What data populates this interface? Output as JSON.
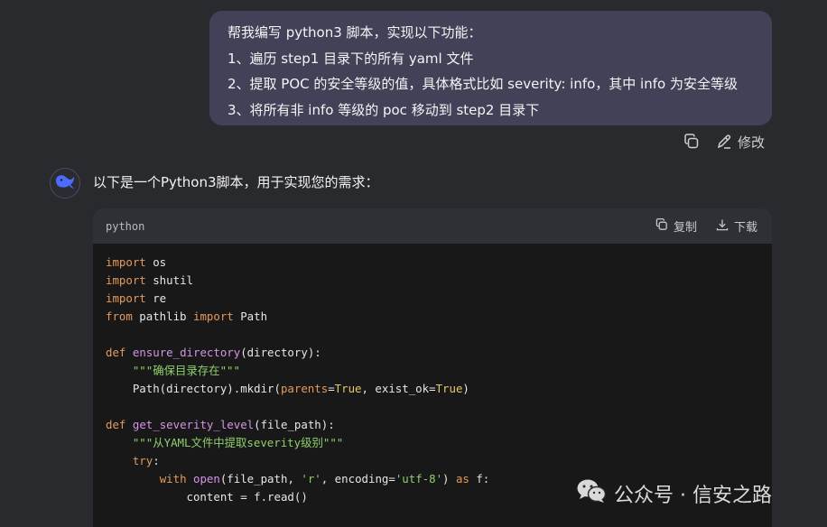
{
  "user_message": {
    "lines": [
      "帮我编写 python3 脚本，实现以下功能：",
      "1、遍历 step1 目录下的所有 yaml 文件",
      "2、提取 POC 的安全等级的值，具体格式比如 severity: info，其中 info 为安全等级",
      "3、将所有非 info 等级的 poc 移动到 step2 目录下"
    ],
    "actions": {
      "copy_icon": "copy-icon",
      "edit_label": "修改",
      "edit_icon": "pencil-icon"
    }
  },
  "assistant": {
    "avatar_icon": "whale-logo-icon",
    "intro": "以下是一个Python3脚本，用于实现您的需求：",
    "code_block": {
      "language": "python",
      "copy_label": "复制",
      "download_label": "下载",
      "lines": [
        [
          [
            "kw",
            "import"
          ],
          [
            "t",
            " os"
          ]
        ],
        [
          [
            "kw",
            "import"
          ],
          [
            "t",
            " shutil"
          ]
        ],
        [
          [
            "kw",
            "import"
          ],
          [
            "t",
            " re"
          ]
        ],
        [
          [
            "kw",
            "from"
          ],
          [
            "t",
            " pathlib "
          ],
          [
            "kw",
            "import"
          ],
          [
            "t",
            " Path"
          ]
        ],
        [],
        [
          [
            "kw",
            "def"
          ],
          [
            "t",
            " "
          ],
          [
            "fn",
            "ensure_directory"
          ],
          [
            "t",
            "(directory):"
          ]
        ],
        [
          [
            "t",
            "    "
          ],
          [
            "st",
            "\"\"\"确保目录存在\"\"\""
          ]
        ],
        [
          [
            "t",
            "    Path(directory).mkdir("
          ],
          [
            "pr",
            "parents"
          ],
          [
            "t",
            "="
          ],
          [
            "bo",
            "True"
          ],
          [
            "t",
            ", exist_ok="
          ],
          [
            "bo",
            "True"
          ],
          [
            "t",
            ")"
          ]
        ],
        [],
        [
          [
            "kw",
            "def"
          ],
          [
            "t",
            " "
          ],
          [
            "fn",
            "get_severity_level"
          ],
          [
            "t",
            "(file_path):"
          ]
        ],
        [
          [
            "t",
            "    "
          ],
          [
            "st",
            "\"\"\"从YAML文件中提取severity级别\"\"\""
          ]
        ],
        [
          [
            "t",
            "    "
          ],
          [
            "kw",
            "try"
          ],
          [
            "t",
            ":"
          ]
        ],
        [
          [
            "t",
            "        "
          ],
          [
            "kw",
            "with"
          ],
          [
            "t",
            " "
          ],
          [
            "bi",
            "open"
          ],
          [
            "t",
            "(file_path, "
          ],
          [
            "st",
            "'r'"
          ],
          [
            "t",
            ", encoding="
          ],
          [
            "st",
            "'utf-8'"
          ],
          [
            "t",
            ") "
          ],
          [
            "kw",
            "as"
          ],
          [
            "t",
            " f:"
          ]
        ],
        [
          [
            "t",
            "            content = f.read()"
          ]
        ]
      ]
    }
  },
  "watermark": {
    "icon": "wechat-icon",
    "text": "公众号 · 信安之路"
  },
  "colors": {
    "background": "#292a2d",
    "user_bubble": "#414158",
    "code_bg": "#181818",
    "code_header": "#2f3035"
  }
}
